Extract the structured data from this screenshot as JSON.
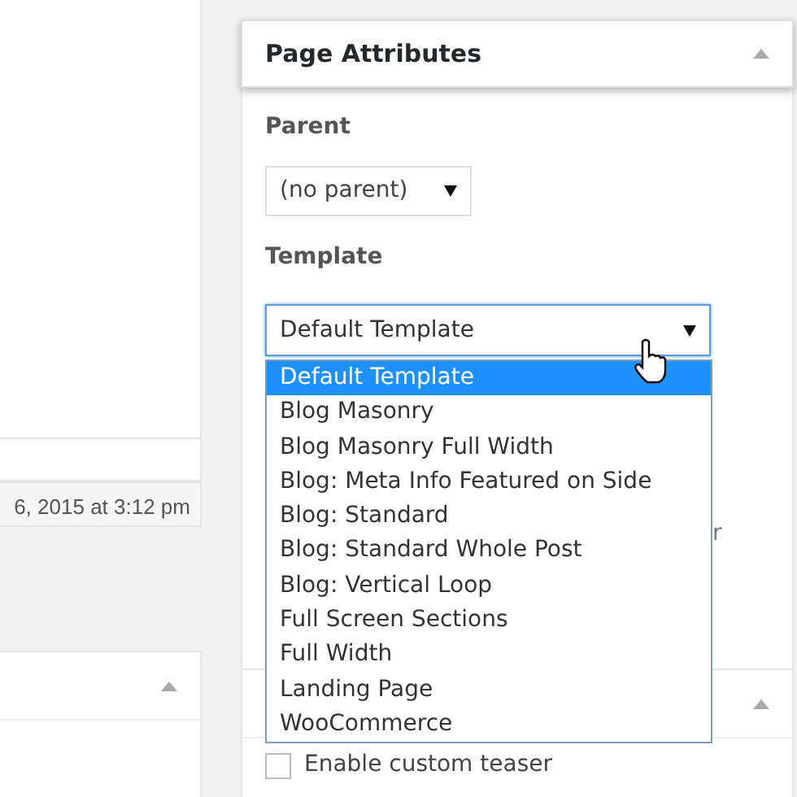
{
  "left_panel": {
    "date_text": "6, 2015 at 3:12 pm"
  },
  "page_attributes": {
    "title": "Page Attributes",
    "parent_label": "Parent",
    "parent_value": "(no parent)",
    "template_label": "Template",
    "template_value": "Default Template",
    "behind_text": "r",
    "template_options": [
      {
        "label": "Default Template",
        "selected": true
      },
      {
        "label": "Blog Masonry",
        "selected": false
      },
      {
        "label": "Blog Masonry Full Width",
        "selected": false
      },
      {
        "label": "Blog: Meta Info Featured on Side",
        "selected": false
      },
      {
        "label": "Blog: Standard",
        "selected": false
      },
      {
        "label": "Blog: Standard Whole Post",
        "selected": false
      },
      {
        "label": "Blog: Vertical Loop",
        "selected": false
      },
      {
        "label": "Full Screen Sections",
        "selected": false
      },
      {
        "label": "Full Width",
        "selected": false
      },
      {
        "label": "Landing Page",
        "selected": false
      },
      {
        "label": "WooCommerce",
        "selected": false
      }
    ]
  },
  "lower_right_panel": {
    "checkbox_label": "Enable custom teaser",
    "checked": false
  }
}
